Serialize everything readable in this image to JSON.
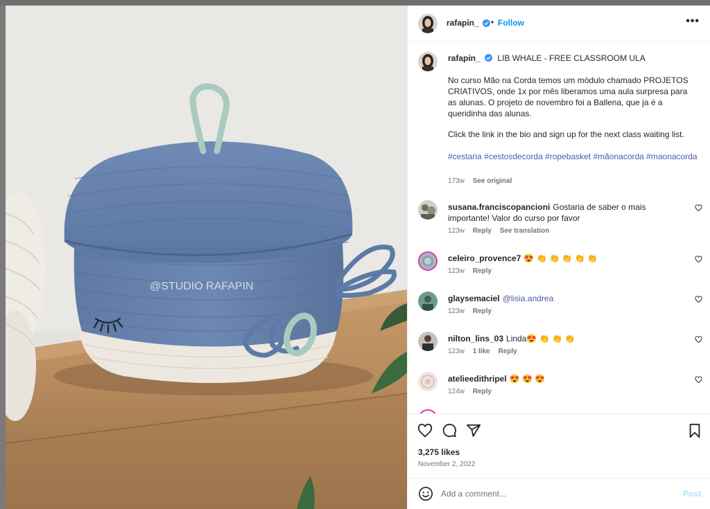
{
  "post": {
    "username": "rafapin_",
    "follow_label": "Follow",
    "separator": "•",
    "more_label": "•••",
    "watermark": "@STUDIO RAFAPIN",
    "caption": {
      "username": "rafapin_",
      "title": "LIB WHALE - FREE CLASSROOM ULA",
      "paragraph1": "No curso Mão na Corda temos um módulo chamado PROJETOS CRIATIVOS, onde 1x por mês liberamos uma aula surpresa para as alunas. O projeto de novembro foi a Ballena, que ja é a queridinha das alunas.",
      "paragraph2": "Click the link in the bio and sign up for the next class waiting list.",
      "hashtags": "#cestaria #cestosdecorda #ropebasket #mãonacorda #maonacorda",
      "time": "173w",
      "see_original": "See original"
    },
    "comments": [
      {
        "username": "susana.franciscopancioni",
        "text": "Gostaria de saber o mais importante! Valor do curso por favor",
        "time": "123w",
        "likes": "",
        "reply": "Reply",
        "extra": "See translation"
      },
      {
        "username": "celeiro_provence7",
        "text": "😍 👏 👏 👏 👏 👏",
        "time": "123w",
        "likes": "",
        "reply": "Reply",
        "extra": ""
      },
      {
        "username": "glaysemaciel",
        "text": "",
        "mention": "@lisia.andrea",
        "time": "123w",
        "likes": "",
        "reply": "Reply",
        "extra": ""
      },
      {
        "username": "nilton_lins_03",
        "text": "Linda😍 👏 👏 👏",
        "time": "123w",
        "likes": "1 like",
        "reply": "Reply",
        "extra": ""
      },
      {
        "username": "atelieedithripel",
        "text": "😍 😍 😍",
        "time": "124w",
        "likes": "",
        "reply": "Reply",
        "extra": ""
      }
    ],
    "likes": "3,275 likes",
    "date": "November 2, 2022",
    "add_comment_placeholder": "Add a comment...",
    "post_label": "Post"
  },
  "colors": {
    "link": "#0095f6",
    "hashtag": "#4b5aa8",
    "muted": "#737373",
    "post_disabled": "#b2dffc"
  }
}
